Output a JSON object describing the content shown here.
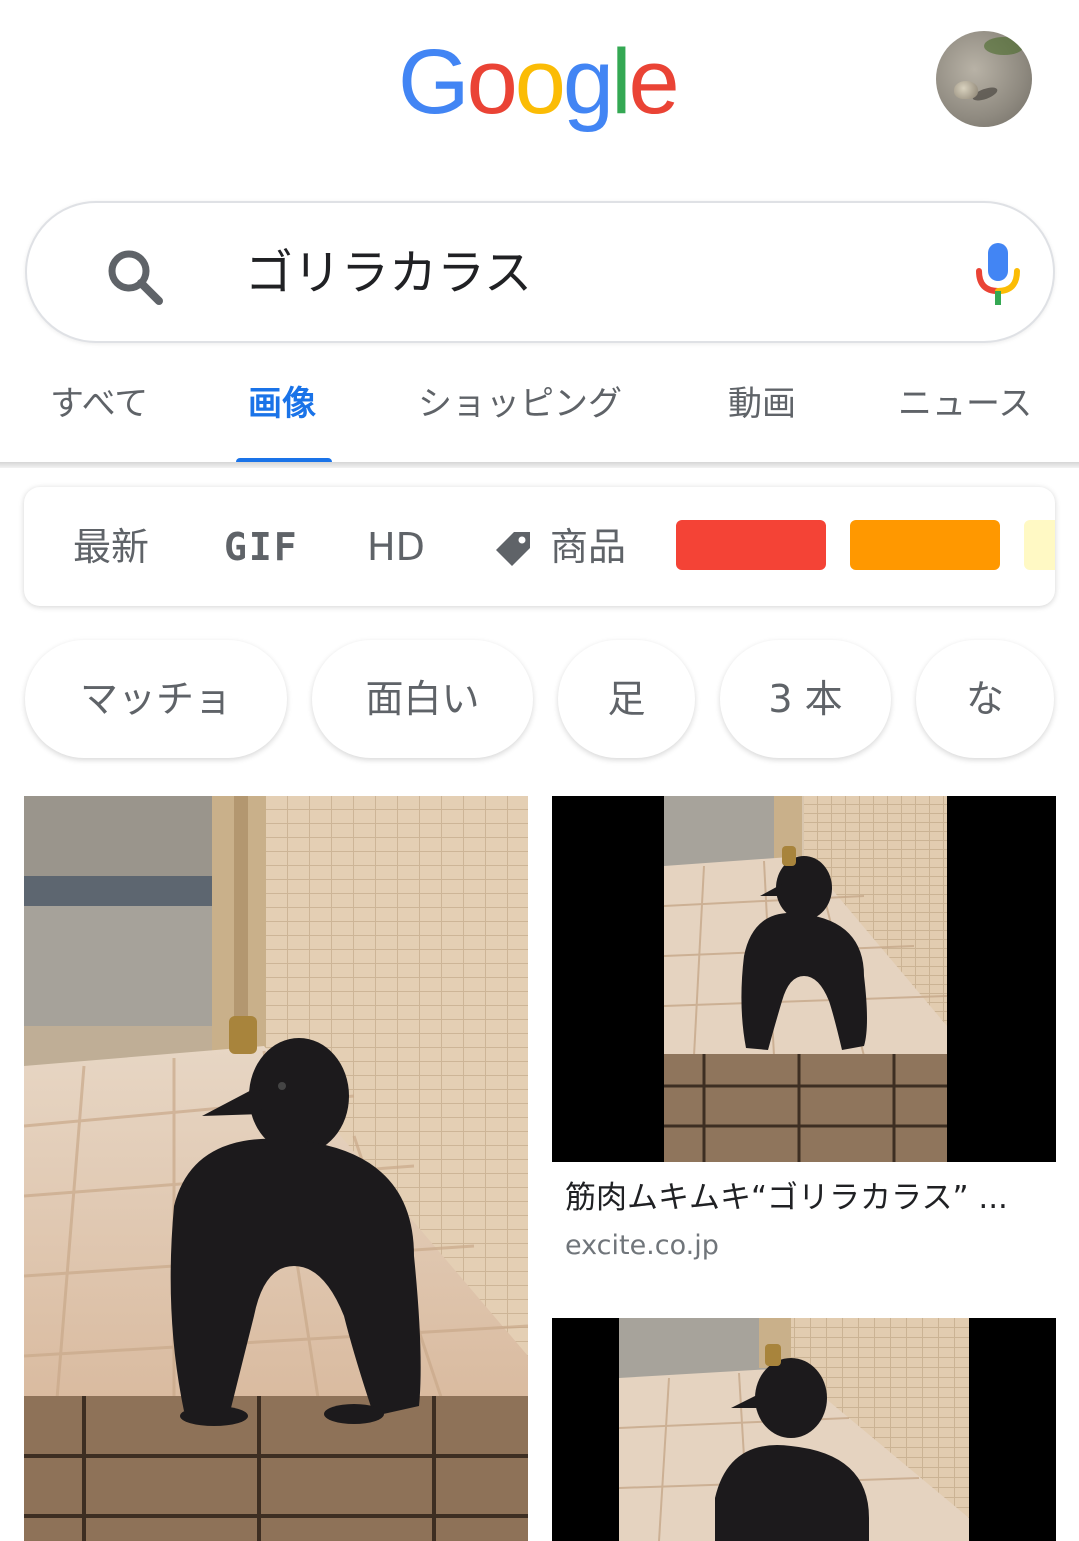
{
  "header": {
    "logo": [
      "G",
      "o",
      "o",
      "g",
      "l",
      "e"
    ],
    "logo_colors": [
      "#4285F4",
      "#EA4335",
      "#FBBC05",
      "#4285F4",
      "#34A853",
      "#EA4335"
    ]
  },
  "search": {
    "query": "ゴリラカラス"
  },
  "tabs": [
    {
      "label": "すべて",
      "active": false
    },
    {
      "label": "画像",
      "active": true
    },
    {
      "label": "ショッピング",
      "active": false
    },
    {
      "label": "動画",
      "active": false
    },
    {
      "label": "ニュース",
      "active": false
    }
  ],
  "tools": {
    "recent": "最新",
    "gif": "GIF",
    "hd": "HD",
    "products": "商品",
    "color_swatches": [
      "#F44336",
      "#FF9800",
      "#FFF9C4"
    ]
  },
  "related_chips": [
    "マッチョ",
    "面白い",
    "足",
    "3 本",
    "な"
  ],
  "results": [
    {
      "title": "",
      "source": ""
    },
    {
      "title": "筋肉ムキムキ“ゴリラカラス” ...",
      "source": "excite.co.jp"
    },
    {
      "title": "",
      "source": ""
    }
  ],
  "colors": {
    "accent": "#1a73e8",
    "text_secondary": "#5f6368",
    "source": "#70757a"
  }
}
